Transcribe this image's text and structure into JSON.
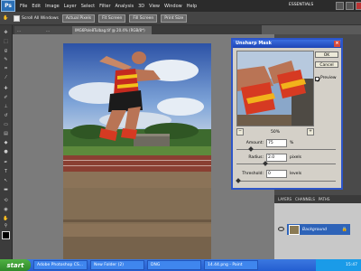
{
  "menubar": {
    "logo": "Ps",
    "items": [
      "File",
      "Edit",
      "Image",
      "Layer",
      "Select",
      "Filter",
      "Analysis",
      "3D",
      "View",
      "Window",
      "Help"
    ],
    "workspace": "ESSENTIALS"
  },
  "options": {
    "scroll_all_label": "Scroll All Windows",
    "buttons": [
      "Actual Pixels",
      "Fit Screen",
      "Fill Screen",
      "Print Size"
    ]
  },
  "document_tabs": [
    "…",
    "…",
    "IMG6Pole8Tulbag.tif @ 20.4% (RGB/8*)"
  ],
  "dialog": {
    "title": "Unsharp Mask",
    "ok_label": "OK",
    "cancel_label": "Cancel",
    "preview_label": "Preview",
    "preview_checked": true,
    "zoom_minus": "−",
    "zoom_value": "50%",
    "zoom_plus": "+",
    "amount_label": "Amount:",
    "amount_value": "75",
    "amount_unit": "%",
    "radius_label": "Radius:",
    "radius_value": "2.0",
    "radius_unit": "pixels",
    "threshold_label": "Threshold:",
    "threshold_value": "0",
    "threshold_unit": "levels"
  },
  "layers": {
    "tabs": [
      "LAYERS",
      "CHANNELS",
      "PATHS"
    ],
    "layer_name": "Background"
  },
  "taskbar": {
    "start_label": "start",
    "tasks": [
      "Adobe Photoshop CS...",
      "New Folder (2)",
      "DNG",
      "14.44.png - Paint"
    ],
    "clock": "15:47"
  },
  "colors": {
    "title_bar": "#2d55c8",
    "layer_selected": "#2e63b8"
  }
}
